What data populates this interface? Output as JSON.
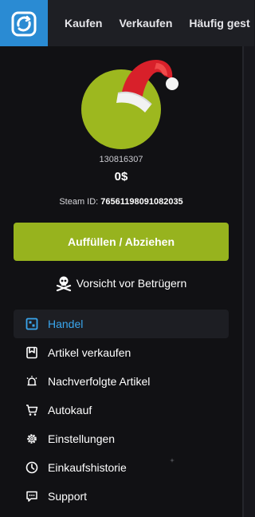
{
  "header": {
    "logo_icon": "refresh-circle-logo",
    "brand_color": "#2a8bd3",
    "nav": [
      {
        "label": "Kaufen"
      },
      {
        "label": "Verkaufen"
      },
      {
        "label": "Häufig gest"
      }
    ]
  },
  "profile": {
    "avatar_color": "#9db81f",
    "user_id": "130816307",
    "balance": "0$",
    "steam_label": "Steam ID:",
    "steam_id": "76561198091082035"
  },
  "actions": {
    "fund_label": "Auffüllen / Abziehen",
    "fund_color": "#97b31e",
    "warning_label": "Vorsicht vor Betrügern"
  },
  "menu": {
    "active_color": "#3aa6ee",
    "items": [
      {
        "label": "Handel",
        "icon": "trade-icon",
        "active": true
      },
      {
        "label": "Artikel verkaufen",
        "icon": "sell-icon",
        "active": false
      },
      {
        "label": "Nachverfolgte Artikel",
        "icon": "tracked-icon",
        "active": false
      },
      {
        "label": "Autokauf",
        "icon": "cart-icon",
        "active": false
      },
      {
        "label": "Einstellungen",
        "icon": "gear-icon",
        "active": false
      },
      {
        "label": "Einkaufshistorie",
        "icon": "clock-icon",
        "active": false
      },
      {
        "label": "Support",
        "icon": "chat-icon",
        "active": false
      }
    ]
  }
}
